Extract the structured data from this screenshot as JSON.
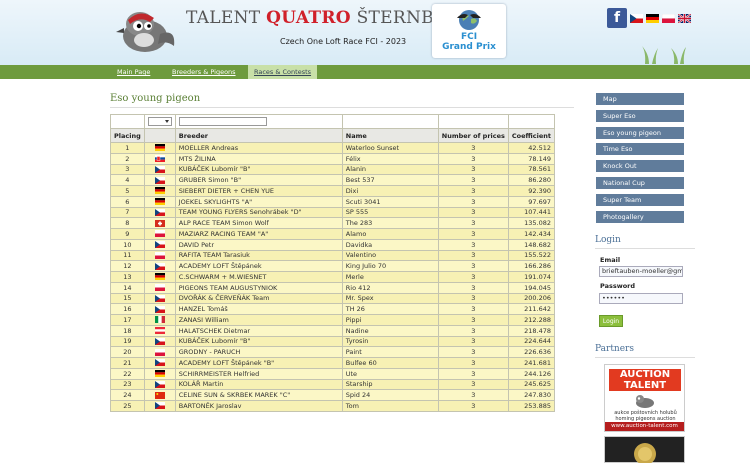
{
  "header": {
    "title_a": "TALENT ",
    "title_b": "QUATRO",
    "title_c": " ŠTERNBERK",
    "subtitle": "Czech One Loft Race FCI - 2023",
    "fci_line1": "FCI",
    "fci_line2": "Grand Prix",
    "facebook_label": "f"
  },
  "nav": [
    {
      "label": "Main Page"
    },
    {
      "label": "Breeders & Pigeons"
    },
    {
      "label": "Races & Contests"
    }
  ],
  "page": {
    "title": "Eso young pigeon"
  },
  "table": {
    "columns": [
      "Placing",
      "",
      "Breeder",
      "Name",
      "Number of prices",
      "Coefficient"
    ],
    "rows": [
      {
        "place": "1",
        "flag": "de",
        "breeder": "MOELLER Andreas",
        "name": "Waterloo Sunset",
        "prices": "3",
        "coef": "42.512"
      },
      {
        "place": "2",
        "flag": "sk",
        "breeder": "MTS ŽILINA",
        "name": "Félix",
        "prices": "3",
        "coef": "78.149"
      },
      {
        "place": "3",
        "flag": "cz",
        "breeder": "KUBÁČEK Lubomír \"B\"",
        "name": "Alanin",
        "prices": "3",
        "coef": "78.561"
      },
      {
        "place": "4",
        "flag": "cz",
        "breeder": "GRUBER Simon \"B\"",
        "name": "Best 537",
        "prices": "3",
        "coef": "86.280"
      },
      {
        "place": "5",
        "flag": "de",
        "breeder": "SIEBERT DIETER + CHEN YUE",
        "name": "Dixi",
        "prices": "3",
        "coef": "92.390"
      },
      {
        "place": "6",
        "flag": "de",
        "breeder": "JOEKEL SKYLIGHTS \"A\"",
        "name": "Scuti 3041",
        "prices": "3",
        "coef": "97.697"
      },
      {
        "place": "7",
        "flag": "cz",
        "breeder": "TEAM YOUNG FLYERS Senohrábek \"D\"",
        "name": "SP 555",
        "prices": "3",
        "coef": "107.441"
      },
      {
        "place": "8",
        "flag": "ch",
        "breeder": "ALP RACE TEAM Simon Wolf",
        "name": "The 283",
        "prices": "3",
        "coef": "135.082"
      },
      {
        "place": "9",
        "flag": "pl",
        "breeder": "MAZIARZ RACING TEAM \"A\"",
        "name": "Alamo",
        "prices": "3",
        "coef": "142.434"
      },
      {
        "place": "10",
        "flag": "cz",
        "breeder": "DAVID Petr",
        "name": "Davidka",
        "prices": "3",
        "coef": "148.682"
      },
      {
        "place": "11",
        "flag": "pl",
        "breeder": "RAFITA TEAM Tarasiuk",
        "name": "Valentino",
        "prices": "3",
        "coef": "155.522"
      },
      {
        "place": "12",
        "flag": "cz",
        "breeder": "ACADEMY LOFT Štěpánek",
        "name": "King Julio 70",
        "prices": "3",
        "coef": "166.286"
      },
      {
        "place": "13",
        "flag": "de",
        "breeder": "C.SCHWARM + M.WIESNET",
        "name": "Merle",
        "prices": "3",
        "coef": "191.074"
      },
      {
        "place": "14",
        "flag": "pl",
        "breeder": "PIGEONS TEAM AUGUSTYNIOK",
        "name": "Rio 412",
        "prices": "3",
        "coef": "194.045"
      },
      {
        "place": "15",
        "flag": "cz",
        "breeder": "DVOŘÁK & ČERVEŇÁK Team",
        "name": "Mr. Spex",
        "prices": "3",
        "coef": "200.206"
      },
      {
        "place": "16",
        "flag": "cz",
        "breeder": "HANZEL Tomáš",
        "name": "TH 26",
        "prices": "3",
        "coef": "211.642"
      },
      {
        "place": "17",
        "flag": "it",
        "breeder": "ZANASI William",
        "name": "Pippi",
        "prices": "3",
        "coef": "212.288"
      },
      {
        "place": "18",
        "flag": "at",
        "breeder": "HALATSCHEK Dietmar",
        "name": "Nadine",
        "prices": "3",
        "coef": "218.478"
      },
      {
        "place": "19",
        "flag": "cz",
        "breeder": "KUBÁČEK Lubomír \"B\"",
        "name": "Tyrosin",
        "prices": "3",
        "coef": "224.644"
      },
      {
        "place": "20",
        "flag": "pl",
        "breeder": "GRODNY - PARUCH",
        "name": "Paint",
        "prices": "3",
        "coef": "226.636"
      },
      {
        "place": "21",
        "flag": "cz",
        "breeder": "ACADEMY LOFT Štěpánek \"B\"",
        "name": "Bulfee 60",
        "prices": "3",
        "coef": "241.681"
      },
      {
        "place": "22",
        "flag": "de",
        "breeder": "SCHIRRMEISTER Helfried",
        "name": "Ute",
        "prices": "3",
        "coef": "244.126"
      },
      {
        "place": "23",
        "flag": "cz",
        "breeder": "KOLÁŘ Martin",
        "name": "Starship",
        "prices": "3",
        "coef": "245.625"
      },
      {
        "place": "24",
        "flag": "cn",
        "breeder": "CELINE SUN & SKRBEK MAREK \"C\"",
        "name": "Spid 24",
        "prices": "3",
        "coef": "247.830"
      },
      {
        "place": "25",
        "flag": "cz",
        "breeder": "BARTONĚK Jaroslav",
        "name": "Tom",
        "prices": "3",
        "coef": "253.885"
      }
    ]
  },
  "sidebar": {
    "menu": [
      {
        "label": "Map"
      },
      {
        "label": "Super Eso"
      },
      {
        "label": "Eso young pigeon"
      },
      {
        "label": "Time Eso"
      },
      {
        "label": "Knock Out"
      },
      {
        "label": "National Cup"
      },
      {
        "label": "Super Team"
      },
      {
        "label": "Photogallery"
      }
    ],
    "login": {
      "heading": "Login",
      "email_label": "Email",
      "email_value": "brieftauben-moeller@gm",
      "password_label": "Password",
      "password_value": "••••••",
      "button": "Login"
    },
    "partners": {
      "heading": "Partners",
      "ad_title": "AUCTION TALENT",
      "ad_desc": "aukce poštovních holubů homing pigeons auction",
      "ad_url": "www.auction-talent.com"
    }
  },
  "colors": {
    "nav_green": "#6e9b3e",
    "sidebar_blue": "#607c9b",
    "row_yellow": "#fbf7c6",
    "title_green": "#5a7f35"
  }
}
